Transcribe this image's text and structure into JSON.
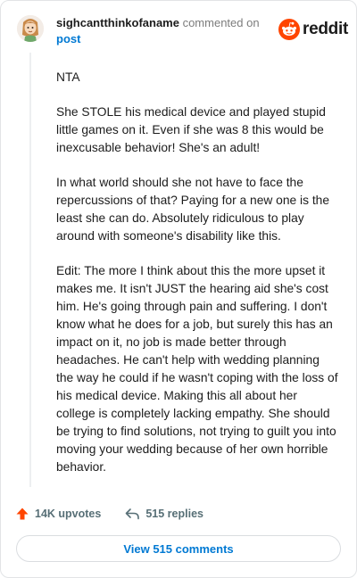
{
  "header": {
    "username": "sighcantthinkofaname",
    "action_text": " commented on ",
    "target_text": "post"
  },
  "brand": {
    "wordmark": "reddit",
    "accent_color": "#ff4500"
  },
  "comment": {
    "paragraphs": [
      "NTA",
      "She STOLE his medical device and played stupid little games on it. Even if she was 8 this would be inexcusable behavior! She's an adult!",
      "In what world should she not have to face the repercussions of that? Paying for a new one is the least she can do. Absolutely ridiculous to play around with someone's disability like this.",
      "Edit: The more I think about this the more upset it makes me. It isn't JUST the hearing aid she's cost him. He's going through pain and suffering. I don't know what he does for a job, but surely this has an impact on it, no job is made better through headaches. He can't help with wedding planning the way he could if he wasn't coping with the loss of his medical device. Making this all about her college is completely lacking empathy. She should be trying to find solutions, not trying to guilt you into moving your wedding because of her own horrible behavior."
    ]
  },
  "actions": {
    "upvotes_label": "14K upvotes",
    "replies_label": "515 replies",
    "upvote_icon": "upvote-arrow-icon",
    "reply_icon": "reply-arrow-icon"
  },
  "footer": {
    "view_comments_label": "View 515 comments"
  }
}
